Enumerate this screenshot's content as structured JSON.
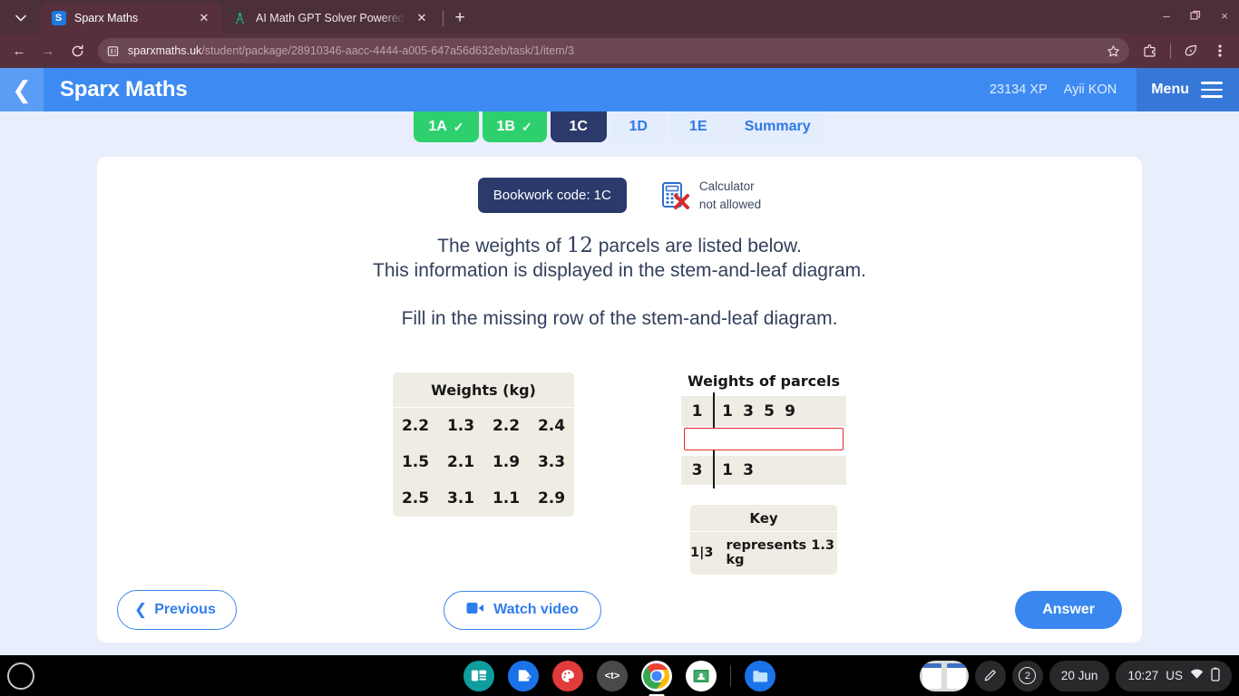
{
  "browser": {
    "tabs": [
      {
        "title": "Sparx Maths",
        "favicon": "sparx-favicon",
        "active": true
      },
      {
        "title": "AI Math GPT Solver Powered by",
        "favicon": "compass-icon",
        "active": false
      }
    ],
    "newtab_label": "+",
    "url_domain": "sparxmaths.uk",
    "url_path": "/student/package/28910346-aacc-4444-a005-647a56d632eb/task/1/item/3",
    "window_controls": {
      "minimize": "–",
      "maximize": "❐",
      "close": "×"
    },
    "toolbar_icons": [
      "back-icon",
      "forward-icon",
      "reload-icon",
      "site-info-icon",
      "bookmark-star-icon",
      "extensions-icon",
      "energy-saver-icon",
      "chrome-menu-icon"
    ]
  },
  "header": {
    "back_label": "‹",
    "brand": "Sparx Maths",
    "xp": "23134 XP",
    "user": "Ayii KON",
    "menu_label": "Menu"
  },
  "subtabs": [
    {
      "label": "1A",
      "state": "done",
      "tick": "✓"
    },
    {
      "label": "1B",
      "state": "done",
      "tick": "✓"
    },
    {
      "label": "1C",
      "state": "active",
      "tick": ""
    },
    {
      "label": "1D",
      "state": "todo",
      "tick": ""
    },
    {
      "label": "1E",
      "state": "todo",
      "tick": ""
    },
    {
      "label": "Summary",
      "state": "todo",
      "tick": ""
    }
  ],
  "question": {
    "bookwork_code": "Bookwork code: 1C",
    "calculator_line1": "Calculator",
    "calculator_line2": "not allowed",
    "line1_pre": "The weights of ",
    "line1_num": "12",
    "line1_post": " parcels are listed below.",
    "line2": "This information is displayed in the stem-and-leaf diagram.",
    "line3": "Fill in the missing row of the stem-and-leaf diagram."
  },
  "weights_table": {
    "header": "Weights (kg)",
    "rows": [
      [
        "2.2",
        "1.3",
        "2.2",
        "2.4"
      ],
      [
        "1.5",
        "2.1",
        "1.9",
        "3.3"
      ],
      [
        "2.5",
        "3.1",
        "1.1",
        "2.9"
      ]
    ]
  },
  "stem_leaf": {
    "title": "Weights of parcels",
    "rows": [
      {
        "stem": "1",
        "leaves": [
          "1",
          "3",
          "5",
          "9"
        ],
        "editable": false
      },
      {
        "stem": "",
        "leaves": [],
        "editable": true,
        "value": ""
      },
      {
        "stem": "3",
        "leaves": [
          "1",
          "3"
        ],
        "editable": false
      }
    ],
    "key_header": "Key",
    "key_notation": "1|3",
    "key_text": "represents 1.3 kg"
  },
  "footer": {
    "previous": "Previous",
    "watch_video": "Watch video",
    "answer": "Answer"
  },
  "shelf": {
    "launcher": "launcher-icon",
    "apps": [
      {
        "name": "news-icon",
        "glyph": "▤",
        "color": "#0f9d9d"
      },
      {
        "name": "docs-icon",
        "glyph": "✎",
        "color": "#1a73e8"
      },
      {
        "name": "paint-icon",
        "glyph": "❀",
        "color": "#e13b3b"
      },
      {
        "name": "code-icon",
        "glyph": "<t>",
        "color": "#4a4a4a"
      },
      {
        "name": "chrome-icon",
        "glyph": "",
        "color": "#ffffff"
      },
      {
        "name": "classroom-icon",
        "glyph": "☰",
        "color": "#ffffff"
      },
      {
        "name": "files-icon",
        "glyph": "▭",
        "color": "#1a73e8"
      }
    ],
    "tray": {
      "screenshot_thumb": "screenshot-thumbnail",
      "stylus": "stylus-icon",
      "notification_count": "2",
      "date": "20 Jun",
      "time": "10:27",
      "locale": "US",
      "wifi": "wifi-icon",
      "battery": "battery-icon"
    }
  },
  "colors": {
    "brand_blue": "#3d8bf2",
    "navy": "#2b3a6b",
    "green": "#2ed06e",
    "answer_red": "#e8282a",
    "paper": "#efece3"
  }
}
